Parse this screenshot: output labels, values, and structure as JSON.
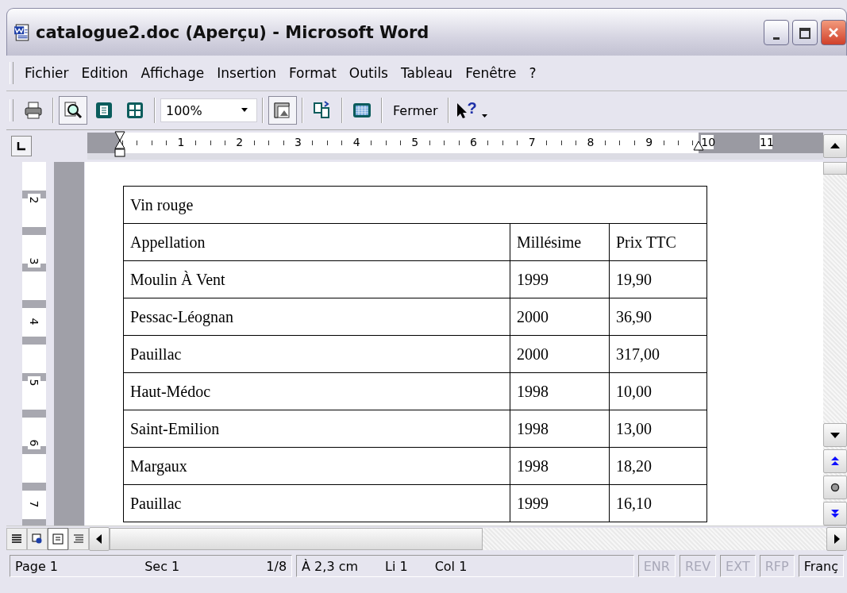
{
  "window": {
    "title": "catalogue2.doc (Aperçu) - Microsoft Word"
  },
  "menu": [
    {
      "label": "Fichier"
    },
    {
      "label": "Edition"
    },
    {
      "label": "Affichage"
    },
    {
      "label": "Insertion"
    },
    {
      "label": "Format"
    },
    {
      "label": "Outils"
    },
    {
      "label": "Tableau"
    },
    {
      "label": "Fenêtre"
    },
    {
      "label": "?"
    }
  ],
  "toolbar": [
    {
      "kind": "print",
      "pressed": false
    },
    {
      "kind": "magnifier",
      "pressed": true
    },
    {
      "kind": "one-page",
      "pressed": false
    },
    {
      "kind": "multiple-pages",
      "pressed": false
    },
    {
      "kind": "zoom",
      "value": "100%"
    },
    {
      "kind": "ruler",
      "pressed": true
    },
    {
      "kind": "shrink",
      "pressed": false
    },
    {
      "kind": "full-screen",
      "pressed": false
    },
    {
      "kind": "text-button",
      "label": "Fermer"
    },
    {
      "kind": "help",
      "pressed": false,
      "label": "?"
    }
  ],
  "ruler": {
    "horizontal": [
      "1",
      "2",
      "3",
      "4",
      "5",
      "6",
      "7",
      "8",
      "9",
      "10",
      "11"
    ],
    "vertical": [
      "2",
      "3",
      "4",
      "5",
      "6",
      "7"
    ]
  },
  "table": {
    "title": "Vin rouge",
    "columns": [
      "Appellation",
      "Millésime",
      "Prix TTC"
    ],
    "rows": [
      [
        "Moulin À Vent",
        "1999",
        "19,90"
      ],
      [
        "Pessac-Léognan",
        "2000",
        "36,90"
      ],
      [
        "Pauillac",
        "2000",
        "317,00"
      ],
      [
        "Haut-Médoc",
        "1998",
        "10,00"
      ],
      [
        "Saint-Emilion",
        "1998",
        "13,00"
      ],
      [
        "Margaux",
        "1998",
        "18,20"
      ],
      [
        "Pauillac",
        "1999",
        "16,10"
      ]
    ]
  },
  "view_buttons": [
    {
      "kind": "normal",
      "selected": false
    },
    {
      "kind": "web",
      "selected": false
    },
    {
      "kind": "print",
      "selected": true
    },
    {
      "kind": "outline",
      "selected": false
    }
  ],
  "status_bar": {
    "groups": [
      [
        {
          "text": "Page 1",
          "disabled": false
        },
        {
          "text": "Sec 1",
          "disabled": false
        },
        {
          "text": "1/8",
          "disabled": false
        }
      ],
      [
        {
          "text": "À 2,3 cm",
          "disabled": false
        },
        {
          "text": "Li 1",
          "disabled": false
        },
        {
          "text": "Col 1",
          "disabled": false
        }
      ],
      [
        {
          "text": "ENR",
          "disabled": true
        }
      ],
      [
        {
          "text": "REV",
          "disabled": true
        }
      ],
      [
        {
          "text": "EXT",
          "disabled": true
        }
      ],
      [
        {
          "text": "RFP",
          "disabled": true
        }
      ],
      [
        {
          "text": "Franç",
          "disabled": false
        }
      ]
    ]
  }
}
